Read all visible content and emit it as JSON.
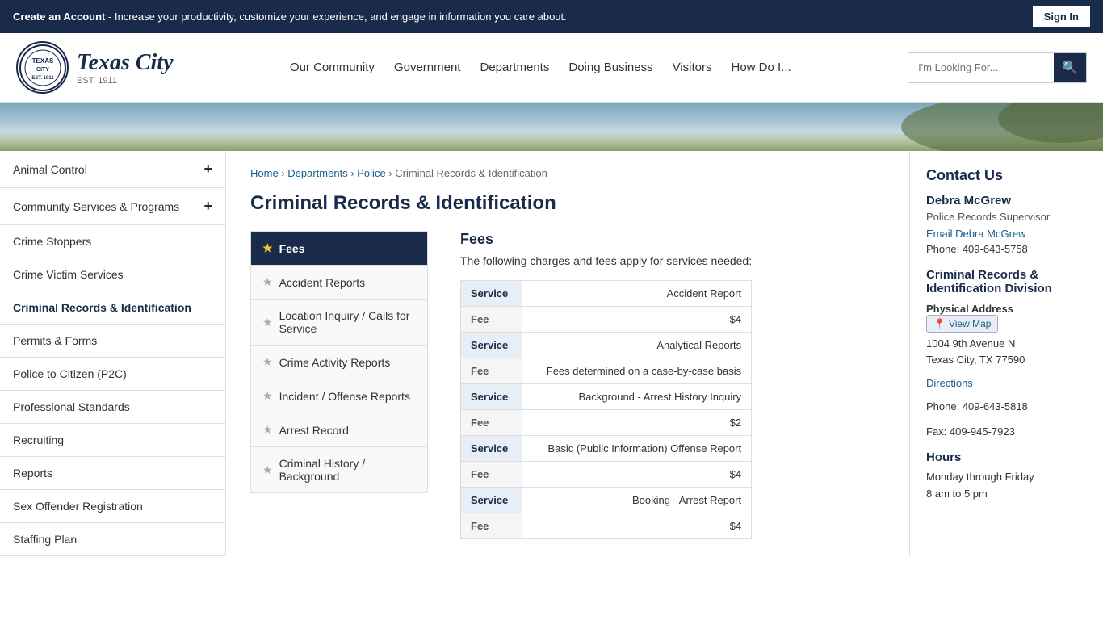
{
  "topBanner": {
    "text": " - Increase your productivity, customize your experience, and engage in information you care about.",
    "createAccount": "Create an Account",
    "signIn": "Sign In"
  },
  "header": {
    "logoText": "Texas City",
    "logoSub": "EST. 1911",
    "navItems": [
      {
        "label": "Our Community",
        "href": "#"
      },
      {
        "label": "Government",
        "href": "#"
      },
      {
        "label": "Departments",
        "href": "#"
      },
      {
        "label": "Doing Business",
        "href": "#"
      },
      {
        "label": "Visitors",
        "href": "#"
      },
      {
        "label": "How Do I...",
        "href": "#"
      }
    ],
    "searchPlaceholder": "I'm Looking For..."
  },
  "breadcrumb": {
    "items": [
      {
        "label": "Home",
        "href": "#"
      },
      {
        "label": "Departments",
        "href": "#"
      },
      {
        "label": "Police",
        "href": "#"
      },
      {
        "label": "Criminal Records & Identification",
        "href": null
      }
    ]
  },
  "pageTitle": "Criminal Records & Identification",
  "sidebar": {
    "items": [
      {
        "label": "Animal Control",
        "hasPlus": true
      },
      {
        "label": "Community Services & Programs",
        "hasPlus": true
      },
      {
        "label": "Crime Stoppers",
        "hasPlus": false
      },
      {
        "label": "Crime Victim Services",
        "hasPlus": false
      },
      {
        "label": "Criminal Records & Identification",
        "hasPlus": false,
        "active": true
      },
      {
        "label": "Permits & Forms",
        "hasPlus": false
      },
      {
        "label": "Police to Citizen (P2C)",
        "hasPlus": false
      },
      {
        "label": "Professional Standards",
        "hasPlus": false
      },
      {
        "label": "Recruiting",
        "hasPlus": false
      },
      {
        "label": "Reports",
        "hasPlus": false
      },
      {
        "label": "Sex Offender Registration",
        "hasPlus": false
      },
      {
        "label": "Staffing Plan",
        "hasPlus": false
      }
    ]
  },
  "subnav": {
    "items": [
      {
        "label": "Fees",
        "active": true
      },
      {
        "label": "Accident Reports",
        "active": false
      },
      {
        "label": "Location Inquiry / Calls for Service",
        "active": false
      },
      {
        "label": "Crime Activity Reports",
        "active": false
      },
      {
        "label": "Incident / Offense Reports",
        "active": false
      },
      {
        "label": "Arrest Record",
        "active": false
      },
      {
        "label": "Criminal History / Background",
        "active": false
      }
    ]
  },
  "feeSection": {
    "title": "Fees",
    "description": "The following charges and fees apply for services needed:",
    "table": [
      {
        "rowType": "service",
        "label": "Service",
        "value": "Accident Report"
      },
      {
        "rowType": "fee",
        "label": "Fee",
        "value": "$4"
      },
      {
        "rowType": "service",
        "label": "Service",
        "value": "Analytical Reports"
      },
      {
        "rowType": "fee",
        "label": "Fee",
        "value": "Fees determined on a case-by-case basis"
      },
      {
        "rowType": "service",
        "label": "Service",
        "value": "Background - Arrest History Inquiry"
      },
      {
        "rowType": "fee",
        "label": "Fee",
        "value": "$2"
      },
      {
        "rowType": "service",
        "label": "Service",
        "value": "Basic (Public Information) Offense Report"
      },
      {
        "rowType": "fee",
        "label": "Fee",
        "value": "$4"
      },
      {
        "rowType": "service",
        "label": "Service",
        "value": "Booking - Arrest Report"
      },
      {
        "rowType": "fee",
        "label": "Fee",
        "value": "$4"
      }
    ]
  },
  "contact": {
    "sectionTitle": "Contact Us",
    "name": "Debra McGrew",
    "role": "Police Records Supervisor",
    "email": "Email Debra McGrew",
    "phone": "Phone: 409-643-5758",
    "divisionTitle": "Criminal Records & Identification Division",
    "addressLabel": "Physical Address",
    "viewMap": "View Map",
    "address1": "1004 9th Avenue N",
    "address2": "Texas City, TX 77590",
    "directions": "Directions",
    "phone2": "Phone: 409-643-5818",
    "fax": "Fax: 409-945-7923",
    "hoursTitle": "Hours",
    "hours": "Monday through Friday\n8 am to 5 pm"
  },
  "icons": {
    "search": "&#128269;",
    "star": "&#9733;",
    "starOutline": "&#9733;",
    "pin": "&#128205;",
    "chevron": "&#8250;"
  }
}
